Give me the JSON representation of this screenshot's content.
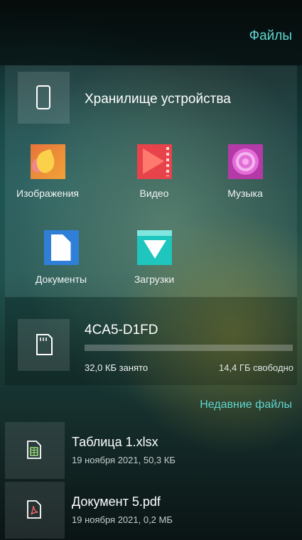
{
  "header": {
    "title": "Файлы"
  },
  "device_storage": {
    "title": "Хранилище устройства",
    "icon": "phone-icon",
    "categories": [
      {
        "label": "Изображения",
        "icon": "images-icon"
      },
      {
        "label": "Видео",
        "icon": "video-icon"
      },
      {
        "label": "Музыка",
        "icon": "music-icon"
      },
      {
        "label": "Документы",
        "icon": "documents-icon"
      },
      {
        "label": "Загрузки",
        "icon": "downloads-icon"
      }
    ]
  },
  "sd_card": {
    "name": "4CA5-D1FD",
    "icon": "sd-card-icon",
    "used": "32,0 КБ занято",
    "free": "14,4 ГБ свободно",
    "used_fraction": 0.0
  },
  "recent": {
    "link": "Недавние файлы",
    "files": [
      {
        "name": "Таблица 1.xlsx",
        "meta": "19 ноября 2021, 50,3 КБ",
        "icon": "spreadsheet-icon"
      },
      {
        "name": "Документ 5.pdf",
        "meta": "19 ноября 2021, 0,2 МБ",
        "icon": "pdf-icon"
      }
    ]
  },
  "colors": {
    "accent": "#5fd6d0",
    "background": "#143a3a"
  }
}
